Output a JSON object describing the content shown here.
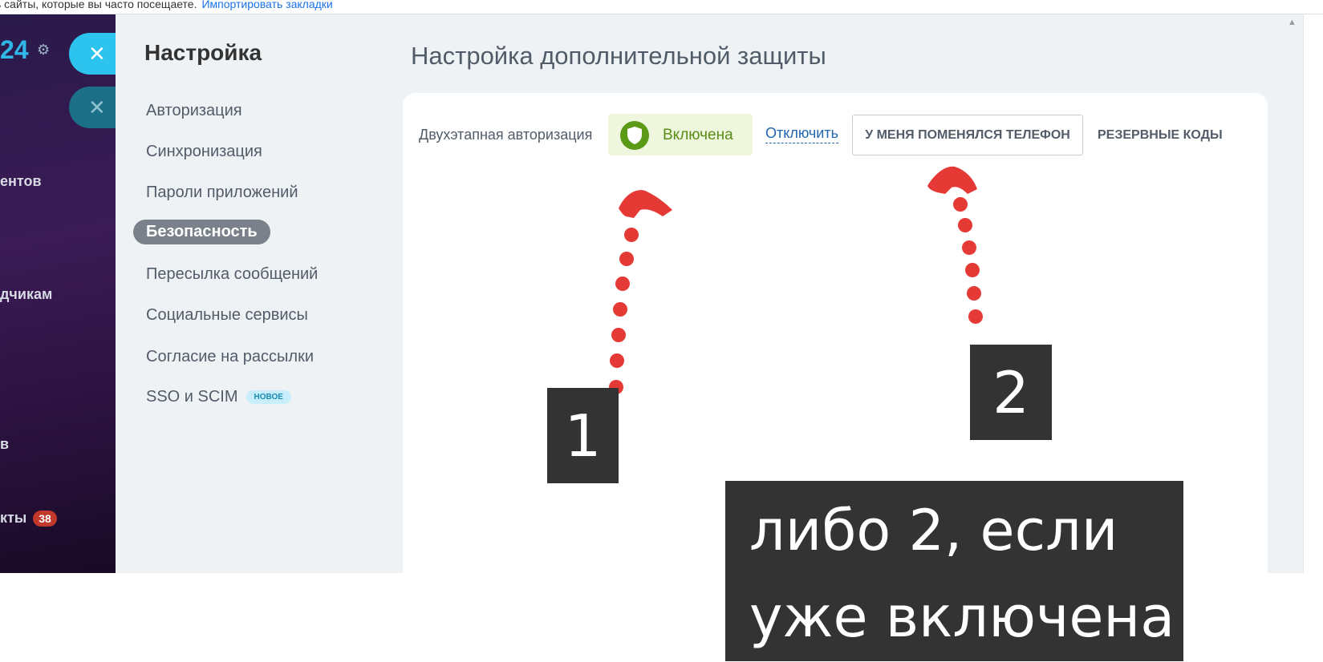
{
  "browser": {
    "hint_text": "ь сайты, которые вы часто посещаете.",
    "import_link": "Импортировать закладки"
  },
  "sidebar": {
    "logo": "24",
    "items": [
      {
        "label": "ентов"
      },
      {
        "label": "дчикам"
      },
      {
        "label": "в"
      },
      {
        "label": "кты"
      }
    ],
    "badge": "38"
  },
  "close_icon": "✕",
  "settings": {
    "title": "Настройка",
    "menu": [
      {
        "label": "Авторизация"
      },
      {
        "label": "Синхронизация"
      },
      {
        "label": "Пароли приложений"
      },
      {
        "label": "Безопасность"
      },
      {
        "label": "Пересылка сообщений"
      },
      {
        "label": "Социальные сервисы"
      },
      {
        "label": "Согласие на рассылки"
      },
      {
        "label": "SSO и SCIM",
        "tag": "НОВОЕ"
      }
    ],
    "active_index": 3
  },
  "main": {
    "title": "Настройка дополнительной защиты",
    "two_step_label": "Двухэтапная авторизация",
    "status": "Включена",
    "status_color": "#5a8c18",
    "disable_link": "Отключить",
    "phone_changed_button": "У МЕНЯ ПОМЕНЯЛСЯ ТЕЛЕФОН",
    "backup_codes_button": "РЕЗЕРВНЫЕ КОДЫ"
  },
  "annotations": {
    "label_1": "1",
    "label_2": "2",
    "note_line1": "либо 2, если",
    "note_line2": "уже включена",
    "arrow_color": "#e53935"
  }
}
